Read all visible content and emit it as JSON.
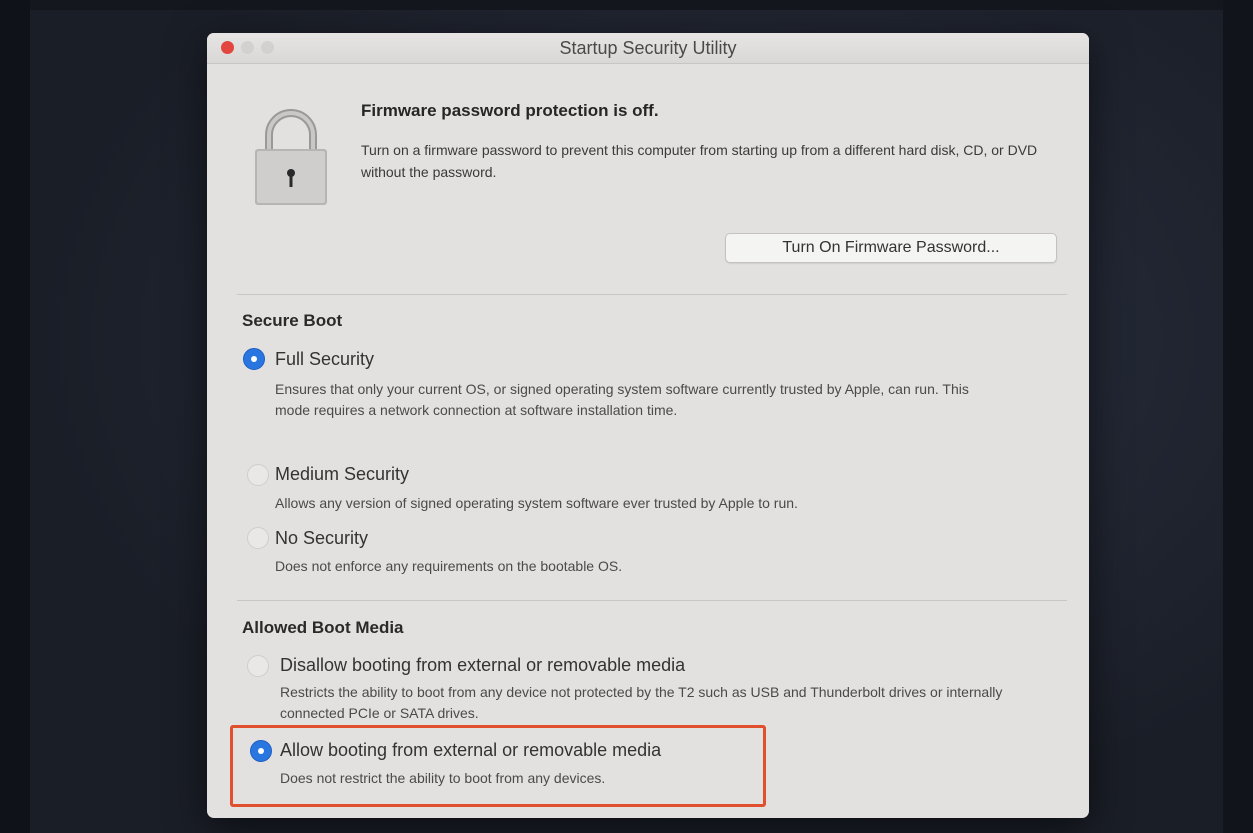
{
  "window": {
    "title": "Startup Security Utility"
  },
  "firmware": {
    "heading": "Firmware password protection is off.",
    "description": "Turn on a firmware password to prevent this computer from starting up from a different hard disk, CD, or DVD without the password.",
    "button_label": "Turn On Firmware Password..."
  },
  "secure_boot": {
    "heading": "Secure Boot",
    "options": [
      {
        "label": "Full Security",
        "description": "Ensures that only your current OS, or signed operating system software currently trusted by Apple, can run. This mode requires a network connection at software installation time.",
        "selected": true
      },
      {
        "label": "Medium Security",
        "description": "Allows any version of signed operating system software ever trusted by Apple to run.",
        "selected": false
      },
      {
        "label": "No Security",
        "description": "Does not enforce any requirements on the bootable OS.",
        "selected": false
      }
    ]
  },
  "boot_media": {
    "heading": "Allowed Boot Media",
    "options": [
      {
        "label": "Disallow booting from external or removable media",
        "description": "Restricts the ability to boot from any device not protected by the T2 such as USB and Thunderbolt drives or internally connected PCIe or SATA drives.",
        "selected": false
      },
      {
        "label": "Allow booting from external or removable media",
        "description": "Does not restrict the ability to boot from any devices.",
        "selected": true
      }
    ]
  },
  "colors": {
    "accent": "#2a76e0",
    "highlight_border": "#e0502e",
    "close_button": "#e2463f"
  }
}
